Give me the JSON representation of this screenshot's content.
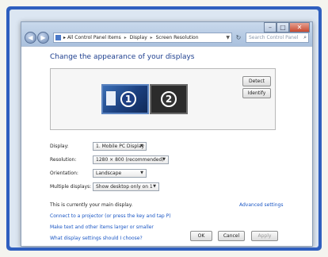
{
  "address_bar": {
    "crumbs": [
      "All Control Panel Items",
      "Display",
      "Screen Resolution"
    ],
    "search_placeholder": "Search Control Panel"
  },
  "main": {
    "title": "Change the appearance of your displays",
    "monitors": [
      {
        "number": "1",
        "selected": true
      },
      {
        "number": "2",
        "selected": false
      }
    ],
    "detect_label": "Detect",
    "identify_label": "Identify"
  },
  "settings": {
    "display": {
      "label": "Display:",
      "value": "1. Mobile PC Display"
    },
    "resolution": {
      "label": "Resolution:",
      "value": "1280 × 800 (recommended)"
    },
    "orientation": {
      "label": "Orientation:",
      "value": "Landscape"
    },
    "multiple": {
      "label": "Multiple displays:",
      "value": "Show desktop only on 1"
    }
  },
  "status_text": "This is currently your main display.",
  "advanced_link": "Advanced settings",
  "links": {
    "projector": "Connect to a projector (or press the  key and tap P)",
    "text_size": "Make text and other items larger or smaller",
    "help": "What display settings should I choose?"
  },
  "footer": {
    "ok": "OK",
    "cancel": "Cancel",
    "apply": "Apply"
  },
  "colors": {
    "frame": "#2f5fbf",
    "link": "#1a56c4",
    "title": "#1e3f8f"
  }
}
